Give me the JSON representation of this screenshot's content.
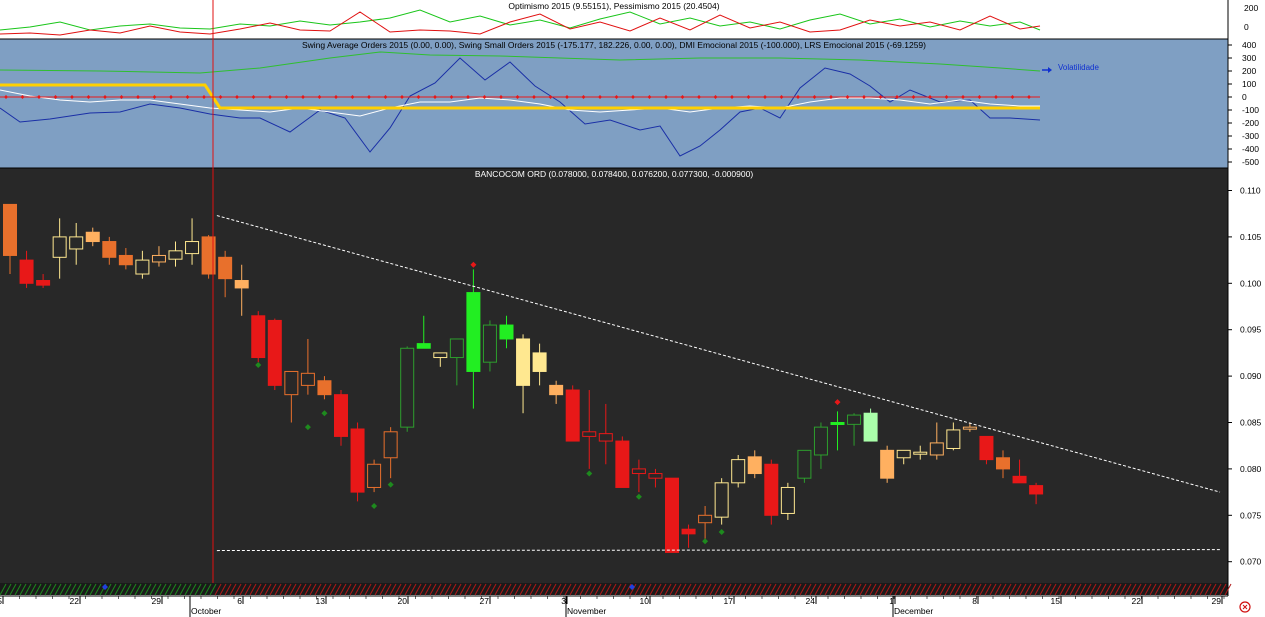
{
  "panels": {
    "sentiment": {
      "title": "Optimismo 2015 (9.55151), Pessimismo 2015 (20.4504)",
      "yticks": [
        "200",
        "0"
      ],
      "colors": {
        "optimismo": "#19c519",
        "pessimismo": "#e01010"
      }
    },
    "swing": {
      "title": "Swing Average Orders 2015 (0.00, 0.00), Swing Small Orders 2015 (-175.177, 182.226, 0.00, 0.00), DMI Emocional 2015 (-100.000), LRS Emocional 2015 (-69.1259)",
      "legend_label": "Volatilidade",
      "yticks": [
        "400",
        "300",
        "200",
        "100",
        "0",
        "-100",
        "-200",
        "-300",
        "-400",
        "-500"
      ],
      "background": "#7f9fc3"
    },
    "price": {
      "title": "BANCOCOM ORD (0.078000, 0.078400, 0.076200, 0.077300, -0.000900)",
      "background": "#282828"
    }
  },
  "date_axis": {
    "day_labels": [
      "5",
      "22",
      "29",
      "6",
      "13",
      "20",
      "27",
      "3",
      "10",
      "17",
      "24",
      "1",
      "8",
      "15",
      "22",
      "29"
    ],
    "month_labels": [
      "October",
      "November",
      "December"
    ]
  },
  "corner_icon": "clock-icon",
  "chart_data": {
    "type": "candlestick",
    "title": "BANCOCOM ORD (0.078000, 0.078400, 0.076200, 0.077300, -0.000900)",
    "ylim": [
      0.0675,
      0.1115
    ],
    "yticks": [
      "0.110",
      "0.105",
      "0.100",
      "0.095",
      "0.090",
      "0.085",
      "0.080",
      "0.075",
      "0.070"
    ],
    "ohlc": [
      [
        0.1085,
        0.1085,
        0.101,
        0.103
      ],
      [
        0.1025,
        0.1035,
        0.0995,
        0.1
      ],
      [
        0.1003,
        0.101,
        0.0995,
        0.0998
      ],
      [
        0.1028,
        0.107,
        0.1005,
        0.105
      ],
      [
        0.1037,
        0.1065,
        0.102,
        0.105
      ],
      [
        0.1055,
        0.106,
        0.104,
        0.1045
      ],
      [
        0.1045,
        0.105,
        0.102,
        0.1028
      ],
      [
        0.103,
        0.1038,
        0.1015,
        0.102
      ],
      [
        0.101,
        0.1035,
        0.1005,
        0.1025
      ],
      [
        0.1023,
        0.104,
        0.1018,
        0.103
      ],
      [
        0.1026,
        0.1045,
        0.1018,
        0.1035
      ],
      [
        0.1032,
        0.107,
        0.102,
        0.1045
      ],
      [
        0.105,
        0.1052,
        0.1005,
        0.101
      ],
      [
        0.1028,
        0.1035,
        0.0985,
        0.1005
      ],
      [
        0.1003,
        0.102,
        0.0965,
        0.0995
      ],
      [
        0.0965,
        0.097,
        0.0915,
        0.092
      ],
      [
        0.096,
        0.0962,
        0.0885,
        0.089
      ],
      [
        0.088,
        0.0905,
        0.085,
        0.0905
      ],
      [
        0.089,
        0.094,
        0.088,
        0.0903
      ],
      [
        0.0895,
        0.09,
        0.0875,
        0.088
      ],
      [
        0.088,
        0.0885,
        0.0825,
        0.0835
      ],
      [
        0.0843,
        0.085,
        0.0765,
        0.0775
      ],
      [
        0.078,
        0.081,
        0.0775,
        0.0805
      ],
      [
        0.0812,
        0.0845,
        0.079,
        0.084
      ],
      [
        0.0845,
        0.0932,
        0.084,
        0.093
      ],
      [
        0.0935,
        0.0965,
        0.093,
        0.093
      ],
      [
        0.092,
        0.0925,
        0.091,
        0.0925
      ],
      [
        0.092,
        0.094,
        0.089,
        0.094
      ],
      [
        0.0905,
        0.1015,
        0.0865,
        0.099
      ],
      [
        0.0915,
        0.096,
        0.0905,
        0.0955
      ],
      [
        0.0955,
        0.0965,
        0.093,
        0.094
      ],
      [
        0.094,
        0.0945,
        0.086,
        0.089
      ],
      [
        0.0925,
        0.0935,
        0.089,
        0.0905
      ],
      [
        0.089,
        0.0895,
        0.087,
        0.088
      ],
      [
        0.0885,
        0.089,
        0.083,
        0.083
      ],
      [
        0.084,
        0.0885,
        0.08,
        0.0835
      ],
      [
        0.0838,
        0.087,
        0.0805,
        0.083
      ],
      [
        0.083,
        0.0835,
        0.079,
        0.078
      ],
      [
        0.0795,
        0.081,
        0.0775,
        0.08
      ],
      [
        0.079,
        0.08,
        0.078,
        0.0795
      ],
      [
        0.079,
        0.079,
        0.0715,
        0.071
      ],
      [
        0.0735,
        0.074,
        0.0715,
        0.073
      ],
      [
        0.0742,
        0.076,
        0.072,
        0.075
      ],
      [
        0.0748,
        0.079,
        0.074,
        0.0785
      ],
      [
        0.0785,
        0.0815,
        0.078,
        0.081
      ],
      [
        0.0813,
        0.082,
        0.079,
        0.0795
      ],
      [
        0.0805,
        0.081,
        0.074,
        0.075
      ],
      [
        0.0752,
        0.0785,
        0.0745,
        0.078
      ],
      [
        0.079,
        0.082,
        0.0785,
        0.082
      ],
      [
        0.0815,
        0.085,
        0.08,
        0.0845
      ],
      [
        0.085,
        0.0862,
        0.082,
        0.085
      ],
      [
        0.0848,
        0.086,
        0.0825,
        0.0858
      ],
      [
        0.086,
        0.0865,
        0.083,
        0.083
      ],
      [
        0.082,
        0.0825,
        0.0785,
        0.079
      ],
      [
        0.0812,
        0.082,
        0.0805,
        0.082
      ],
      [
        0.0818,
        0.0825,
        0.081,
        0.0818
      ],
      [
        0.0828,
        0.085,
        0.081,
        0.0815
      ],
      [
        0.0822,
        0.085,
        0.082,
        0.0842
      ],
      [
        0.0845,
        0.085,
        0.084,
        0.0843
      ],
      [
        0.0835,
        0.0835,
        0.0805,
        0.081
      ],
      [
        0.0812,
        0.082,
        0.079,
        0.08
      ],
      [
        0.0792,
        0.081,
        0.0785,
        0.0785
      ],
      [
        0.0782,
        0.0785,
        0.0762,
        0.0773
      ]
    ],
    "candle_colors": [
      "#e8702c",
      "#e81818",
      "#e81818",
      "#ffe890",
      "#ffe890",
      "#ffb060",
      "#e8702c",
      "#e8702c",
      "#ffe890",
      "#ffb060",
      "#ffe890",
      "#ffe890",
      "#e8702c",
      "#e8702c",
      "#ffb060",
      "#e81818",
      "#e81818",
      "#e8702c",
      "#e8702c",
      "#e8702c",
      "#e81818",
      "#e81818",
      "#e8702c",
      "#e8702c",
      "#2d9e2d",
      "#22ee22",
      "#ffe890",
      "#2d9e2d",
      "#22ee22",
      "#2d9e2d",
      "#22ee22",
      "#ffe890",
      "#ffe890",
      "#ffb060",
      "#e81818",
      "#e81818",
      "#e81818",
      "#e81818",
      "#e81818",
      "#e81818",
      "#e81818",
      "#e81818",
      "#e8702c",
      "#ffe890",
      "#ffe890",
      "#ffb060",
      "#e81818",
      "#ffe890",
      "#2d9e2d",
      "#2d9e2d",
      "#22ee22",
      "#2d9e2d",
      "#aaffaa",
      "#ffb060",
      "#ffe890",
      "#ffe890",
      "#ffb060",
      "#ffe890",
      "#ffb060",
      "#e81818",
      "#e8702c",
      "#e81818",
      "#e81818"
    ],
    "filled": [
      true,
      true,
      true,
      false,
      false,
      true,
      true,
      true,
      false,
      false,
      false,
      false,
      true,
      true,
      true,
      true,
      true,
      false,
      false,
      true,
      true,
      true,
      false,
      false,
      false,
      true,
      false,
      false,
      true,
      false,
      true,
      true,
      true,
      true,
      true,
      false,
      false,
      true,
      false,
      false,
      true,
      true,
      false,
      false,
      false,
      true,
      true,
      false,
      false,
      false,
      true,
      false,
      true,
      true,
      false,
      false,
      false,
      false,
      false,
      true,
      true,
      true,
      true
    ],
    "markers": [
      {
        "i": 15,
        "y": 0.0912,
        "color": "#1e8a1e"
      },
      {
        "i": 18,
        "y": 0.0845,
        "color": "#1e8a1e"
      },
      {
        "i": 19,
        "y": 0.086,
        "color": "#1e8a1e"
      },
      {
        "i": 22,
        "y": 0.076,
        "color": "#1e8a1e"
      },
      {
        "i": 23,
        "y": 0.0783,
        "color": "#1e8a1e"
      },
      {
        "i": 28,
        "y": 0.102,
        "color": "#e81818"
      },
      {
        "i": 35,
        "y": 0.0795,
        "color": "#1e8a1e"
      },
      {
        "i": 38,
        "y": 0.077,
        "color": "#1e8a1e"
      },
      {
        "i": 42,
        "y": 0.0722,
        "color": "#1e8a1e"
      },
      {
        "i": 43,
        "y": 0.0732,
        "color": "#1e8a1e"
      },
      {
        "i": 50,
        "y": 0.0872,
        "color": "#e81818"
      }
    ],
    "trendline": {
      "from": [
        12.5,
        0.1073
      ],
      "to": [
        72.5,
        0.0775
      ]
    },
    "support": {
      "from": [
        12.5,
        0.0712
      ],
      "to": [
        72.5,
        0.0713
      ]
    },
    "event_line_index": 12.0
  }
}
